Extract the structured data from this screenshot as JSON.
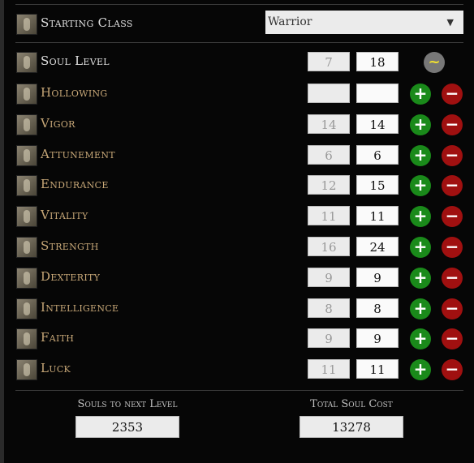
{
  "starting_class": {
    "label": "Starting Class",
    "value": "Warrior"
  },
  "soul_level": {
    "label": "Soul Level",
    "base": "7",
    "current": "18",
    "reset_symbol": "~"
  },
  "stats": [
    {
      "name": "Hollowing",
      "base": "",
      "current": ""
    },
    {
      "name": "Vigor",
      "base": "14",
      "current": "14"
    },
    {
      "name": "Attunement",
      "base": "6",
      "current": "6"
    },
    {
      "name": "Endurance",
      "base": "12",
      "current": "15"
    },
    {
      "name": "Vitality",
      "base": "11",
      "current": "11"
    },
    {
      "name": "Strength",
      "base": "16",
      "current": "24"
    },
    {
      "name": "Dexterity",
      "base": "9",
      "current": "9"
    },
    {
      "name": "Intelligence",
      "base": "8",
      "current": "8"
    },
    {
      "name": "Faith",
      "base": "9",
      "current": "9"
    },
    {
      "name": "Luck",
      "base": "11",
      "current": "11"
    }
  ],
  "buttons": {
    "plus": "+",
    "minus": "−"
  },
  "footer": {
    "souls_next_label": "Souls to next Level",
    "souls_next": "2353",
    "total_label": "Total Soul Cost",
    "total": "13278"
  }
}
